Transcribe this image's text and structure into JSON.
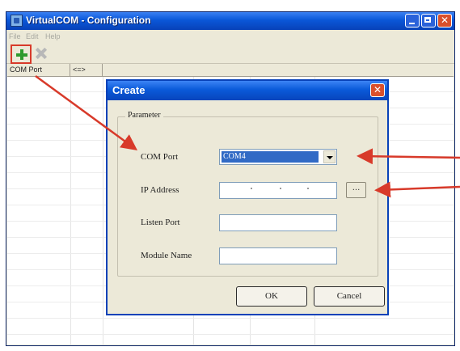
{
  "main_window": {
    "title": "VirtualCOM - Configuration",
    "menu": [
      "File",
      "Edit",
      "Help"
    ],
    "columns": [
      "COM Port",
      "<=>"
    ]
  },
  "dialog": {
    "title": "Create",
    "group_label": "Parameter",
    "com_port_label": "COM Port",
    "com_port_value": "COM4",
    "ip_address_label": "IP Address",
    "ip_address_value": ". . .",
    "browse_label": "...",
    "listen_port_label": "Listen Port",
    "listen_port_value": "",
    "module_name_label": "Module Name",
    "module_name_value": "",
    "ok_label": "OK",
    "cancel_label": "Cancel"
  },
  "icons": {
    "add": "plus-icon",
    "delete": "x-icon",
    "window_close": "close-icon"
  },
  "colors": {
    "titlebar": "#0a57d8",
    "selection": "#316ac5",
    "annotation": "#d83a2a",
    "add_icon": "#2e9a2e"
  }
}
